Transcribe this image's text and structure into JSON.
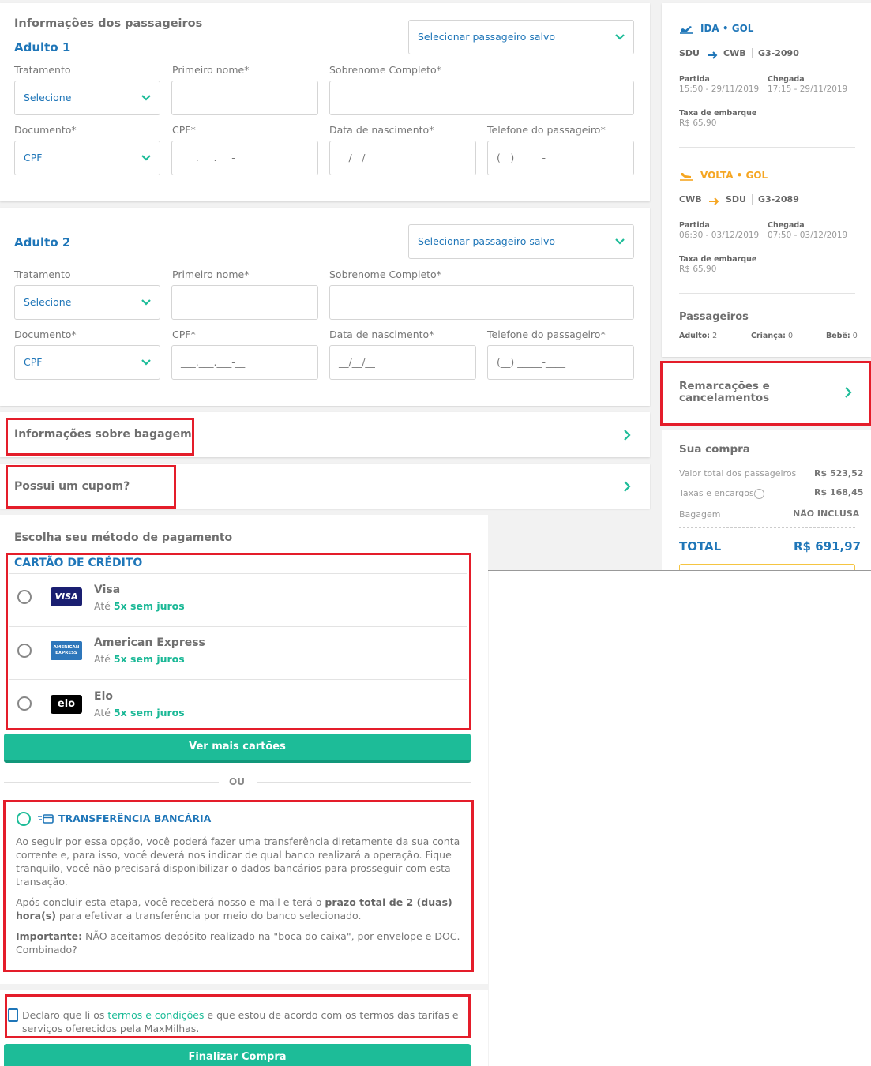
{
  "passengers": {
    "section_title": "Informações dos passageiros",
    "adult1": {
      "title": "Adulto 1",
      "saved_passenger": "Selecionar passageiro salvo",
      "treatment_label": "Tratamento",
      "treatment_value": "Selecione",
      "first_name_label": "Primeiro nome*",
      "surname_label": "Sobrenome Completo*",
      "document_label": "Documento*",
      "document_value": "CPF",
      "cpf_label": "CPF*",
      "cpf_placeholder": "___.___.___-__",
      "birth_label": "Data de nascimento*",
      "birth_placeholder": "__/__/__",
      "phone_label": "Telefone do passageiro*",
      "phone_placeholder": "(__) _____-____"
    },
    "adult2": {
      "title": "Adulto 2",
      "saved_passenger": "Selecionar passageiro salvo",
      "treatment_label": "Tratamento",
      "treatment_value": "Selecione",
      "first_name_label": "Primeiro nome*",
      "surname_label": "Sobrenome Completo*",
      "document_label": "Documento*",
      "document_value": "CPF",
      "cpf_label": "CPF*",
      "cpf_placeholder": "___.___.___-__",
      "birth_label": "Data de nascimento*",
      "birth_placeholder": "__/__/__",
      "phone_label": "Telefone do passageiro*",
      "phone_placeholder": "(__) _____-____"
    }
  },
  "baggage_info": "Informações sobre bagagem",
  "coupon": "Possui um cupom?",
  "payment": {
    "title": "Escolha seu método de pagamento",
    "credit_card_title": "CARTÃO DE CRÉDITO",
    "cards": [
      {
        "name": "Visa",
        "prefix": "Até",
        "installments": "5x sem juros",
        "logo_text": "VISA"
      },
      {
        "name": "American Express",
        "prefix": "Até",
        "installments": "5x sem juros",
        "logo_text": "AMERICAN EXPRESS"
      },
      {
        "name": "Elo",
        "prefix": "Até",
        "installments": "5x sem juros",
        "logo_text": "elo"
      }
    ],
    "more_cards": "Ver mais cartões",
    "or": "OU",
    "bank_transfer_title": "TRANSFERÊNCIA BANCÁRIA",
    "bank_p1": "Ao seguir por essa opção, você poderá fazer uma transferência diretamente da sua conta corrente e, para isso, você deverá nos indicar de qual banco realizará a operação. Fique tranquilo, você não precisará disponibilizar o dados bancários para prosseguir com esta transação.",
    "bank_p2_a": "Após concluir esta etapa, você receberá nosso e-mail e terá o ",
    "bank_p2_bold": "prazo total de 2 (duas) hora(s)",
    "bank_p2_b": " para efetivar a transferência por meio do banco selecionado.",
    "bank_p3_bold": "Importante:",
    "bank_p3": " NÃO aceitamos depósito realizado na \"boca do caixa\", por envelope e DOC. Combinado?"
  },
  "terms": {
    "text_a": "Declaro que li os ",
    "link": "termos e condições",
    "text_b": " e que estou de acordo com os termos das tarifas e serviços oferecidos pela MaxMilhas."
  },
  "finish_button": "Finalizar Compra",
  "sidebar": {
    "outbound": {
      "title": "IDA • GOL",
      "from": "SDU",
      "to": "CWB",
      "flight": "G3-2090",
      "departure_label": "Partida",
      "departure": "15:50 - 29/11/2019",
      "arrival_label": "Chegada",
      "arrival": "17:15 - 29/11/2019",
      "fee_label": "Taxa de embarque",
      "fee": "R$ 65,90"
    },
    "return": {
      "title": "VOLTA • GOL",
      "from": "CWB",
      "to": "SDU",
      "flight": "G3-2089",
      "departure_label": "Partida",
      "departure": "06:30 - 03/12/2019",
      "arrival_label": "Chegada",
      "arrival": "07:50 - 03/12/2019",
      "fee_label": "Taxa de embarque",
      "fee": "R$ 65,90"
    },
    "passengers_title": "Passageiros",
    "adult_label": "Adulto:",
    "adult_count": "2",
    "child_label": "Criança:",
    "child_count": "0",
    "baby_label": "Bebê:",
    "baby_count": "0",
    "changes": "Remarcações e cancelamentos",
    "purchase_title": "Sua compra",
    "total_pass_label": "Valor total dos passageiros",
    "total_pass": "R$ 523,52",
    "taxes_label": "Taxas e encargos",
    "taxes": "R$ 168,45",
    "baggage_label": "Bagagem",
    "baggage": "NÃO INCLUSA",
    "total_label": "TOTAL",
    "total": "R$ 691,97"
  },
  "colors": {
    "accent_blue": "#1f76b8",
    "accent_green": "#1dbc98",
    "highlight_red": "#e41d2a",
    "return_orange": "#f5a623"
  }
}
